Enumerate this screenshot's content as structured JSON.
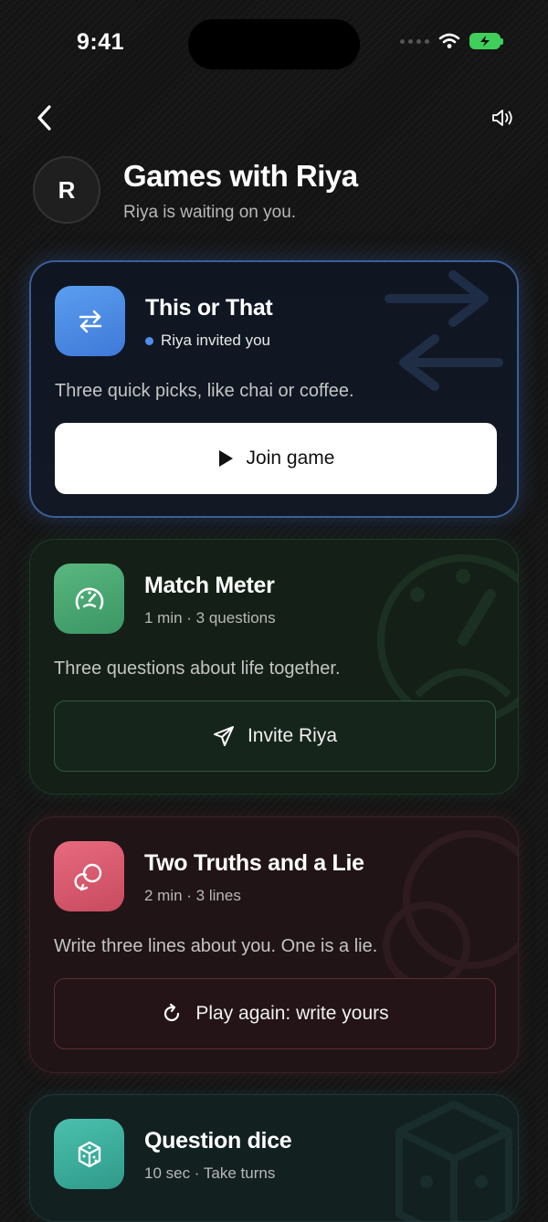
{
  "status_bar": {
    "time": "9:41"
  },
  "header": {
    "avatar_initial": "R",
    "title": "Games with Riya",
    "subtitle": "Riya is waiting on you."
  },
  "games": [
    {
      "title": "This or That",
      "meta": "Riya invited you",
      "description": "Three quick picks, like chai or coffee.",
      "action_label": "Join game",
      "icon": "swap-arrows-icon",
      "accent": "#4f8ee8"
    },
    {
      "title": "Match Meter",
      "meta": "1 min · 3 questions",
      "description": "Three questions about life together.",
      "action_label": "Invite Riya",
      "icon": "gauge-icon",
      "accent": "#4aa672"
    },
    {
      "title": "Two Truths and a Lie",
      "meta": "2 min · 3 lines",
      "description": "Write three lines about you. One is a lie.",
      "action_label": "Play again: write yours",
      "icon": "chat-bubbles-icon",
      "accent": "#d85a6e"
    },
    {
      "title": "Question dice",
      "meta": "10 sec · Take turns",
      "icon": "dice-icon",
      "accent": "#3bae9b"
    }
  ]
}
